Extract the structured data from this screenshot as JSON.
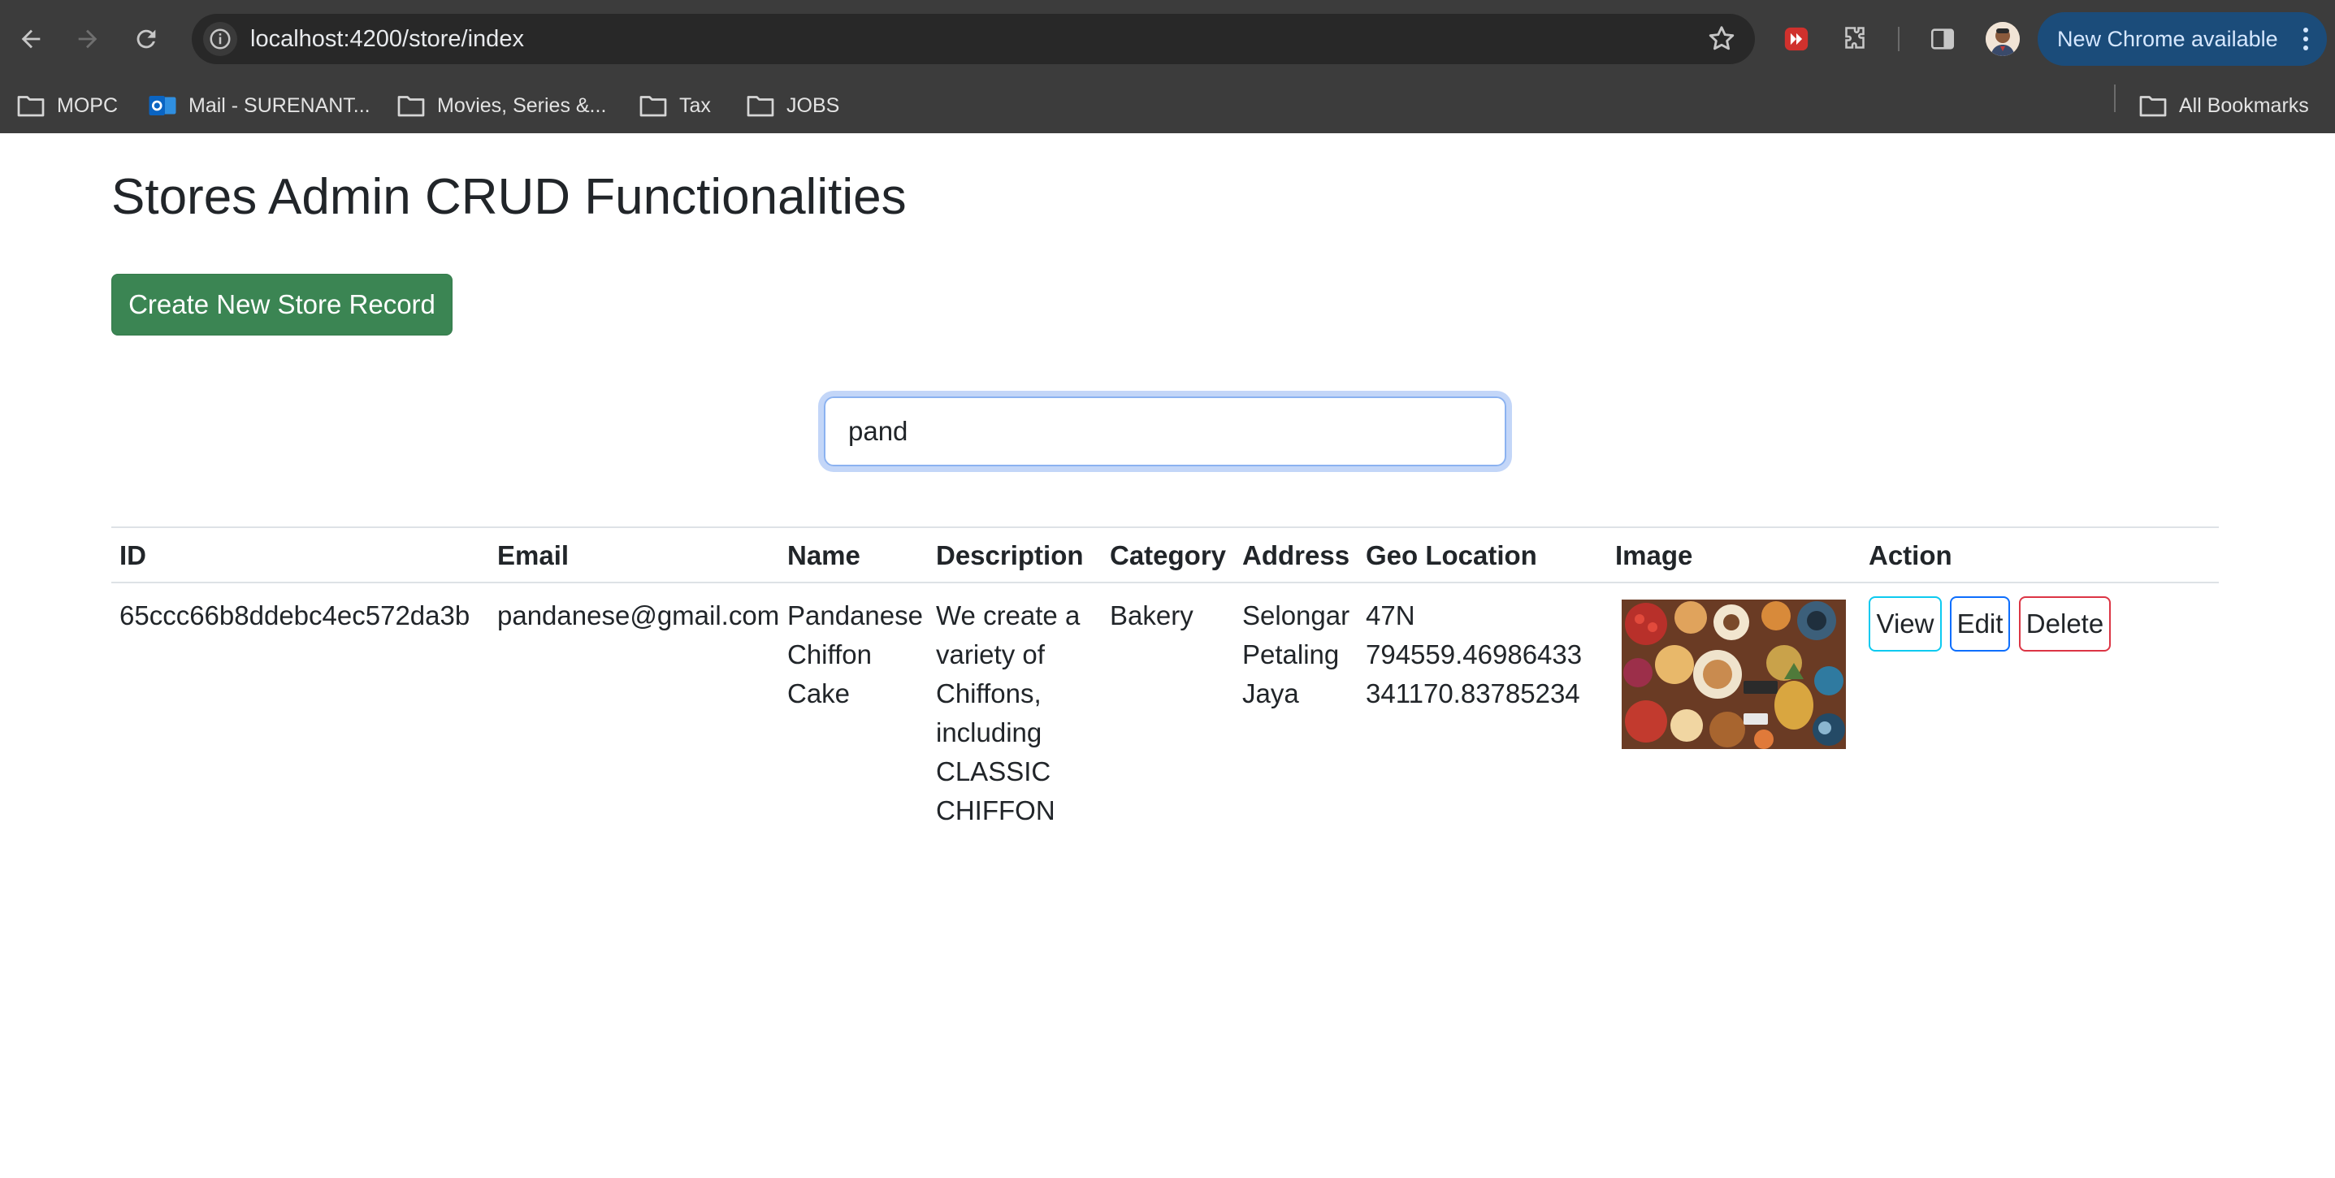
{
  "browser": {
    "url": "localhost:4200/store/index",
    "update_label": "New Chrome available",
    "bookmarks": [
      {
        "label": "MOPC",
        "icon": "folder-icon"
      },
      {
        "label": "Mail - SURENANT...",
        "icon": "outlook-icon"
      },
      {
        "label": "Movies, Series &...",
        "icon": "folder-icon"
      },
      {
        "label": "Tax",
        "icon": "folder-icon"
      },
      {
        "label": "JOBS",
        "icon": "folder-icon"
      }
    ],
    "all_bookmarks_label": "All Bookmarks"
  },
  "page": {
    "title": "Stores Admin CRUD Functionalities",
    "create_button": "Create New Store Record",
    "search_value": "pand"
  },
  "table": {
    "headers": [
      "ID",
      "Email",
      "Name",
      "Description",
      "Category",
      "Address",
      "Geo Location",
      "Image",
      "Action"
    ],
    "rows": [
      {
        "id": "65ccc66b8ddebc4ec572da3b",
        "email": "pandanese@gmail.com",
        "name_lines": [
          "Pandanese",
          "Chiffon",
          "Cake"
        ],
        "description_lines": [
          "We create a",
          "variety of",
          "Chiffons,",
          "including",
          "CLASSIC",
          "CHIFFON"
        ],
        "category": "Bakery",
        "address_lines": [
          "Selongar",
          "Petaling",
          "Jaya"
        ],
        "geo_lines": [
          "47N",
          "794559.46986433",
          "341170.83785234"
        ],
        "actions": {
          "view": "View",
          "edit": "Edit",
          "delete": "Delete"
        }
      }
    ]
  },
  "colors": {
    "chrome_bg": "#3c3c3c",
    "success_button": "#3b8553",
    "view_outline": "#0dcaf0",
    "edit_outline": "#0d6efd",
    "delete_outline": "#dc3545",
    "update_pill": "#1b4c7a"
  }
}
